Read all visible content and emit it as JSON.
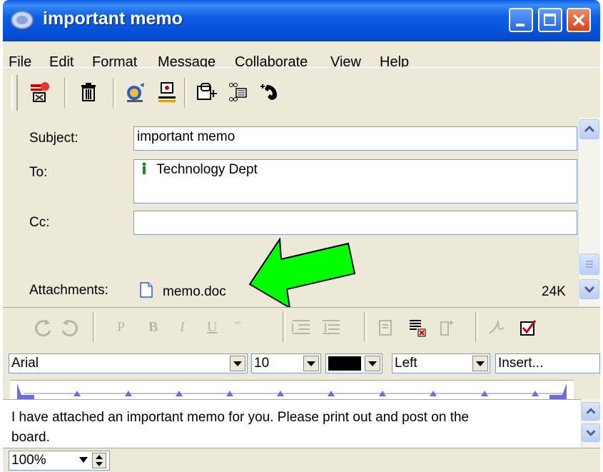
{
  "window": {
    "title": "important memo"
  },
  "menu": {
    "items": [
      {
        "pre": "",
        "key": "F",
        "post": "ile"
      },
      {
        "pre": "",
        "key": "E",
        "post": "dit"
      },
      {
        "pre": "For",
        "key": "m",
        "post": "at"
      },
      {
        "pre": "",
        "key": "M",
        "post": "essage"
      },
      {
        "pre": "",
        "key": "C",
        "post": "ollaborate"
      },
      {
        "pre": "",
        "key": "V",
        "post": "iew"
      },
      {
        "pre": "",
        "key": "H",
        "post": "elp"
      }
    ]
  },
  "toolbar": {
    "icons": [
      "send-icon",
      "delete-icon",
      "address-book-icon",
      "check-names-icon",
      "attach-icon",
      "schedule-icon",
      "phone-icon"
    ]
  },
  "header": {
    "subject_label": "Subject:",
    "subject_value": "important memo",
    "to_label": "To:",
    "to_value": "Technology Dept",
    "cc_label": "Cc:",
    "cc_value": "",
    "attachments_label": "Attachments:",
    "attachment_name": "memo.doc",
    "attachment_size": "24K"
  },
  "format_toolbar": {
    "icons": [
      "undo-icon",
      "redo-icon",
      "plain-text-icon",
      "bold-icon",
      "italic-icon",
      "underline-icon",
      "quote-icon",
      "indent-icon",
      "outdent-icon",
      "spell-check-icon",
      "numbered-list-icon",
      "insert-icon",
      "signature-icon",
      "checkbox-icon"
    ]
  },
  "font_bar": {
    "font": "Arial",
    "size": "10",
    "color": "#000000",
    "align": "Left",
    "insert": "Insert..."
  },
  "body": {
    "text_line1": "I have attached an important memo for you.  Please print out and post on the",
    "text_line2": "board."
  },
  "status": {
    "zoom": "100%"
  },
  "colors": {
    "title_bar": "#0a5de3",
    "arrow": "#00ff00"
  }
}
